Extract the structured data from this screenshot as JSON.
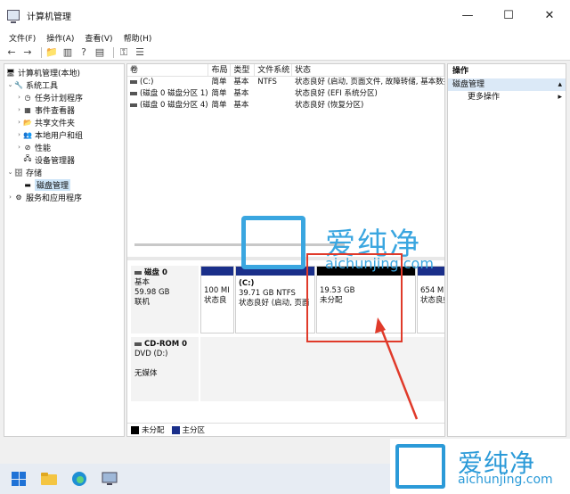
{
  "window": {
    "title": "计算机管理"
  },
  "menu": [
    "文件(F)",
    "操作(A)",
    "查看(V)",
    "帮助(H)"
  ],
  "tree": {
    "root": "计算机管理(本地)",
    "system_tools": "系统工具",
    "task_scheduler": "任务计划程序",
    "event_viewer": "事件查看器",
    "shared_folders": "共享文件夹",
    "local_users": "本地用户和组",
    "performance": "性能",
    "device_manager": "设备管理器",
    "storage": "存储",
    "disk_management": "磁盘管理",
    "services": "服务和应用程序"
  },
  "volumes": {
    "headers": [
      "卷",
      "布局",
      "类型",
      "文件系统",
      "状态"
    ],
    "rows": [
      [
        "(C:)",
        "简单",
        "基本",
        "NTFS",
        "状态良好 (启动, 页面文件, 故障转储, 基本数据"
      ],
      [
        "(磁盘 0 磁盘分区 1)",
        "简单",
        "基本",
        "",
        "状态良好 (EFI 系统分区)"
      ],
      [
        "(磁盘 0 磁盘分区 4)",
        "简单",
        "基本",
        "",
        "状态良好 (恢复分区)"
      ]
    ]
  },
  "disk0": {
    "name": "磁盘 0",
    "type": "基本",
    "size": "59.98 GB",
    "status": "联机",
    "partitions": [
      {
        "size": "100 MI",
        "status": "状态良"
      },
      {
        "title": "(C:)",
        "size": "39.71 GB NTFS",
        "status": "状态良好 (启动, 页面"
      },
      {
        "size": "19.53 GB",
        "status": "未分配"
      },
      {
        "size": "654 MB",
        "status": "状态良好 (恢"
      }
    ]
  },
  "cdrom": {
    "name": "CD-ROM 0",
    "drive": "DVD (D:)",
    "media": "无媒体"
  },
  "legend": {
    "unallocated": "未分配",
    "primary": "主分区"
  },
  "actions": {
    "header": "操作",
    "selected": "磁盘管理",
    "more": "更多操作"
  },
  "watermark": {
    "cn": "爱纯净",
    "en": "aichunjing.com"
  },
  "colors": {
    "primary_partition": "#1a2f8a",
    "unallocated": "#000000",
    "highlight": "#e03a2a",
    "watermark": "#3aa6e0"
  }
}
